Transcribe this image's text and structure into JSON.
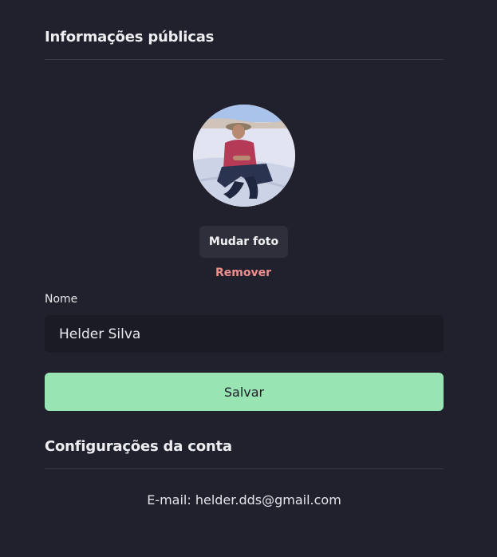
{
  "public_info": {
    "title": "Informações públicas",
    "change_photo_label": "Mudar foto",
    "remove_label": "Remover",
    "name_label": "Nome",
    "name_value": "Helder Silva",
    "save_label": "Salvar"
  },
  "account": {
    "title": "Configurações da conta",
    "email_text": "E-mail: helder.dds@gmail.com"
  },
  "colors": {
    "background": "#20212c",
    "save_button": "#98e4b3",
    "remove_text": "#f08e8e",
    "input_background": "#1a1b24"
  },
  "icons": {
    "avatar": "profile-photo"
  }
}
